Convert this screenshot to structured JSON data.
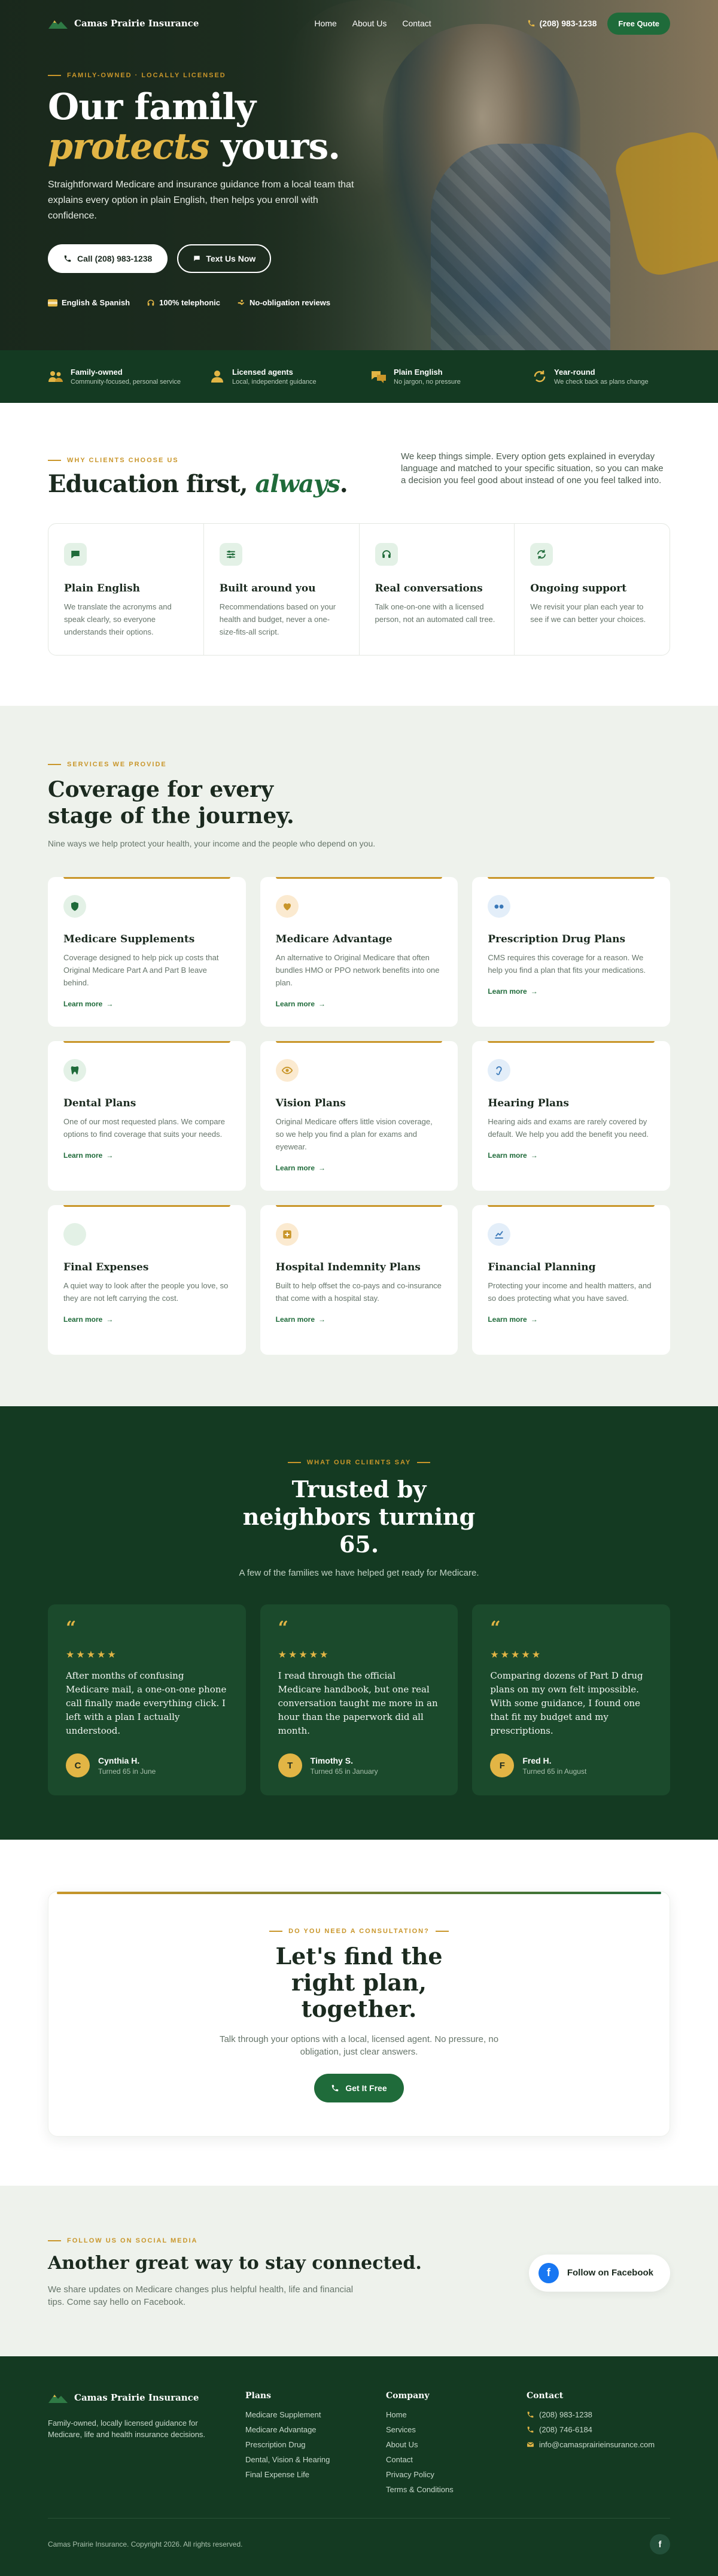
{
  "brand": {
    "name": "Camas Prairie Insurance"
  },
  "nav": {
    "home": "Home",
    "about": "About Us",
    "contact": "Contact",
    "phone": "(208) 983-1238",
    "quote": "Free Quote"
  },
  "hero": {
    "eyebrow": "Family-owned · Locally licensed",
    "title_line1": "Our family",
    "title_em": "protects",
    "title_rest": " yours.",
    "lead": "Straightforward Medicare and insurance guidance from a local team that explains every option in plain English, then helps you enroll with confidence.",
    "call_label": "Call (208) 983-1238",
    "text_label": "Text Us Now",
    "badges": [
      "English & Spanish",
      "100% telephonic",
      "No-obligation reviews"
    ]
  },
  "trustbar": [
    {
      "title": "Family-owned",
      "sub": "Community-focused, personal service"
    },
    {
      "title": "Licensed agents",
      "sub": "Local, independent guidance"
    },
    {
      "title": "Plain English",
      "sub": "No jargon, no pressure"
    },
    {
      "title": "Year-round",
      "sub": "We check back as plans change"
    }
  ],
  "education": {
    "eyebrow": "Why clients choose us",
    "title_main": "Education first, ",
    "title_em": "always",
    "title_end": ".",
    "intro": "We keep things simple. Every option gets explained in everyday language and matched to your specific situation, so you can make a decision you feel good about instead of one you feel talked into.",
    "cards": [
      {
        "title": "Plain English",
        "text": "We translate the acronyms and speak clearly, so everyone understands their options.",
        "icon": "chat-icon"
      },
      {
        "title": "Built around you",
        "text": "Recommendations based on your health and budget, never a one-size-fits-all script.",
        "icon": "sliders-icon"
      },
      {
        "title": "Real conversations",
        "text": "Talk one-on-one with a licensed person, not an automated call tree.",
        "icon": "headset-icon"
      },
      {
        "title": "Ongoing support",
        "text": "We revisit your plan each year to see if we can better your choices.",
        "icon": "refresh-icon"
      }
    ]
  },
  "services": {
    "eyebrow": "Services we provide",
    "title": "Coverage for every stage of the journey.",
    "sub": "Nine ways we help protect your health, your income and the people who depend on you.",
    "learn_more": "Learn more",
    "items": [
      {
        "title": "Medicare Supplements",
        "text": "Coverage designed to help pick up costs that Original Medicare Part A and Part B leave behind.",
        "icon": "shield-icon",
        "tone": "green"
      },
      {
        "title": "Medicare Advantage",
        "text": "An alternative to Original Medicare that often bundles HMO or PPO network benefits into one plan.",
        "icon": "heart-icon",
        "tone": "gold"
      },
      {
        "title": "Prescription Drug Plans",
        "text": "CMS requires this coverage for a reason. We help you find a plan that fits your medications.",
        "icon": "pills-icon",
        "tone": "blue"
      },
      {
        "title": "Dental Plans",
        "text": "One of our most requested plans. We compare options to find coverage that suits your needs.",
        "icon": "tooth-icon",
        "tone": "green"
      },
      {
        "title": "Vision Plans",
        "text": "Original Medicare offers little vision coverage, so we help you find a plan for exams and eyewear.",
        "icon": "eye-icon",
        "tone": "gold"
      },
      {
        "title": "Hearing Plans",
        "text": "Hearing aids and exams are rarely covered by default. We help you add the benefit you need.",
        "icon": "ear-icon",
        "tone": "blue"
      },
      {
        "title": "Final Expenses",
        "text": "A quiet way to look after the people you love, so they are not left carrying the cost.",
        "icon": "leaf-icon",
        "tone": "green"
      },
      {
        "title": "Hospital Indemnity Plans",
        "text": "Built to help offset the co-pays and co-insurance that come with a hospital stay.",
        "icon": "hospital-icon",
        "tone": "gold"
      },
      {
        "title": "Financial Planning",
        "text": "Protecting your income and health matters, and so does protecting what you have saved.",
        "icon": "chart-icon",
        "tone": "blue"
      }
    ]
  },
  "testimonials": {
    "eyebrow": "What our clients say",
    "title": "Trusted by neighbors turning 65.",
    "sub": "A few of the families we have helped get ready for Medicare.",
    "quote_mark": "“",
    "stars": "★★★★★",
    "items": [
      {
        "quote": "After months of confusing Medicare mail, a one-on-one phone call finally made everything click. I left with a plan I actually understood.",
        "initial": "C",
        "name": "Cynthia H.",
        "detail": "Turned 65 in June"
      },
      {
        "quote": "I read through the official Medicare handbook, but one real conversation taught me more in an hour than the paperwork did all month.",
        "initial": "T",
        "name": "Timothy S.",
        "detail": "Turned 65 in January"
      },
      {
        "quote": "Comparing dozens of Part D drug plans on my own felt impossible. With some guidance, I found one that fit my budget and my prescriptions.",
        "initial": "F",
        "name": "Fred H.",
        "detail": "Turned 65 in August"
      }
    ]
  },
  "cta": {
    "eyebrow": "Do you need a consultation?",
    "title": "Let's find the right plan, together.",
    "text": "Talk through your options with a local, licensed agent. No pressure, no obligation, just clear answers.",
    "button": "Get It Free"
  },
  "social": {
    "eyebrow": "Follow us on social media",
    "title": "Another great way to stay connected.",
    "text": "We share updates on Medicare changes plus helpful health, life and financial tips. Come say hello on Facebook.",
    "button": "Follow on Facebook",
    "fb_glyph": "f"
  },
  "footer": {
    "tagline": "Family-owned, locally licensed guidance for Medicare, life and health insurance decisions.",
    "plans_title": "Plans",
    "plans": [
      "Medicare Supplement",
      "Medicare Advantage",
      "Prescription Drug",
      "Dental, Vision & Hearing",
      "Final Expense Life"
    ],
    "company_title": "Company",
    "company": [
      "Home",
      "Services",
      "About Us",
      "Contact",
      "Privacy Policy",
      "Terms & Conditions"
    ],
    "contact_title": "Contact",
    "phone1": "(208) 983-1238",
    "phone2": "(208) 746-6184",
    "email": "info@camasprairieinsurance.com",
    "copyright": "Camas Prairie Insurance. Copyright 2026. All rights reserved."
  },
  "colors": {
    "green_dark": "#143a22",
    "green": "#1f6b3a",
    "gold": "#c9962a"
  }
}
